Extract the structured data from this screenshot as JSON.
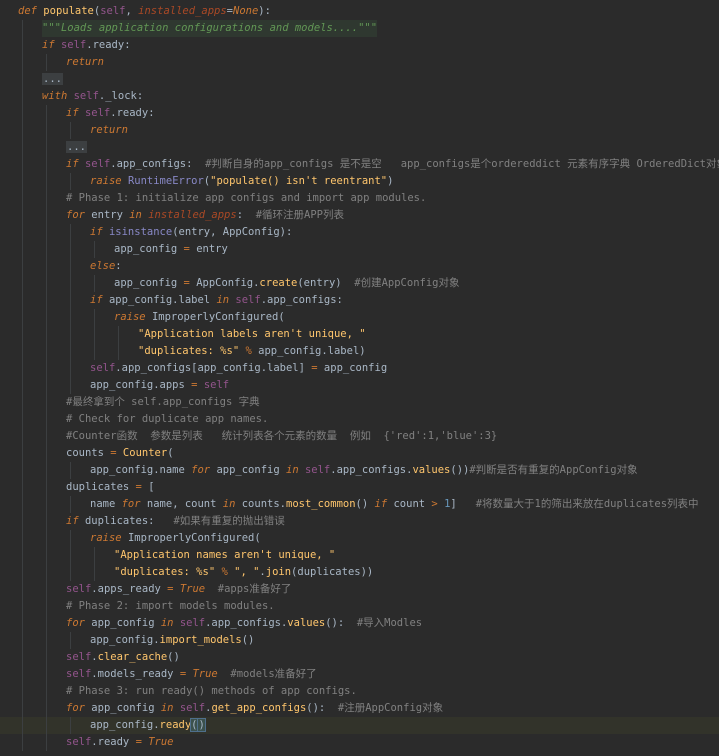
{
  "lines": [
    {
      "indent": 0,
      "tokens": [
        [
          "kw",
          "def "
        ],
        [
          "fn",
          "populate"
        ],
        [
          "name",
          "("
        ],
        [
          "self",
          "self"
        ],
        [
          "name",
          ", "
        ],
        [
          "param",
          "installed_apps"
        ],
        [
          "name",
          "="
        ],
        [
          "kw",
          "None"
        ],
        [
          "name",
          "):"
        ]
      ]
    },
    {
      "indent": 1,
      "doc": true,
      "tokens": [
        [
          "doc",
          "\"\"\"Loads application configurations and models....\"\"\""
        ]
      ]
    },
    {
      "indent": 1,
      "tokens": [
        [
          "kw",
          "if "
        ],
        [
          "self",
          "self"
        ],
        [
          "name",
          ".ready:"
        ]
      ]
    },
    {
      "indent": 2,
      "tokens": [
        [
          "kw",
          "return"
        ]
      ]
    },
    {
      "indent": 1,
      "tokens": [
        [
          "fold",
          "..."
        ]
      ]
    },
    {
      "indent": 1,
      "tokens": [
        [
          "kw",
          "with "
        ],
        [
          "self",
          "self"
        ],
        [
          "name",
          "._lock:"
        ]
      ]
    },
    {
      "indent": 2,
      "tokens": [
        [
          "kw",
          "if "
        ],
        [
          "self",
          "self"
        ],
        [
          "name",
          ".ready:"
        ]
      ]
    },
    {
      "indent": 3,
      "tokens": [
        [
          "kw",
          "return"
        ]
      ]
    },
    {
      "indent": 2,
      "tokens": [
        [
          "fold",
          "..."
        ]
      ]
    },
    {
      "indent": 2,
      "tokens": [
        [
          "kw",
          "if "
        ],
        [
          "self",
          "self"
        ],
        [
          "name",
          ".app_configs:  "
        ],
        [
          "com",
          "#判断自身的app_configs 是不是空   app_configs是个ordereddict 元素有序字典 OrderedDict对象"
        ]
      ]
    },
    {
      "indent": 3,
      "tokens": [
        [
          "kw",
          "raise "
        ],
        [
          "builtin",
          "RuntimeError"
        ],
        [
          "name",
          "("
        ],
        [
          "str",
          "\"populate() isn't reentrant\""
        ],
        [
          "name",
          ")"
        ]
      ]
    },
    {
      "indent": 2,
      "tokens": [
        [
          "com",
          "# Phase 1: initialize app configs and import app modules."
        ]
      ]
    },
    {
      "indent": 2,
      "tokens": [
        [
          "kw",
          "for "
        ],
        [
          "name",
          "entry "
        ],
        [
          "kw",
          "in "
        ],
        [
          "param",
          "installed_apps"
        ],
        [
          "name",
          ":  "
        ],
        [
          "com",
          "#循环注册APP列表"
        ]
      ]
    },
    {
      "indent": 3,
      "tokens": [
        [
          "kw",
          "if "
        ],
        [
          "builtin",
          "isinstance"
        ],
        [
          "name",
          "(entry, AppConfig):"
        ]
      ]
    },
    {
      "indent": 4,
      "tokens": [
        [
          "name",
          "app_config "
        ],
        [
          "kwb",
          "= "
        ],
        [
          "name",
          "entry"
        ]
      ]
    },
    {
      "indent": 3,
      "tokens": [
        [
          "kw",
          "else"
        ],
        [
          "name",
          ":"
        ]
      ]
    },
    {
      "indent": 4,
      "tokens": [
        [
          "name",
          "app_config "
        ],
        [
          "kwb",
          "= "
        ],
        [
          "name",
          "AppConfig."
        ],
        [
          "call",
          "create"
        ],
        [
          "name",
          "(entry)  "
        ],
        [
          "com",
          "#创建AppConfig对象"
        ]
      ]
    },
    {
      "indent": 3,
      "tokens": [
        [
          "kw",
          "if "
        ],
        [
          "name",
          "app_config.label "
        ],
        [
          "kw",
          "in "
        ],
        [
          "self",
          "self"
        ],
        [
          "name",
          ".app_configs:"
        ]
      ]
    },
    {
      "indent": 4,
      "tokens": [
        [
          "kw",
          "raise "
        ],
        [
          "name",
          "ImproperlyConfigured("
        ]
      ]
    },
    {
      "indent": 5,
      "tokens": [
        [
          "str",
          "\"Application labels aren't unique, \""
        ]
      ]
    },
    {
      "indent": 5,
      "tokens": [
        [
          "str",
          "\"duplicates: %s\" "
        ],
        [
          "kwb",
          "% "
        ],
        [
          "name",
          "app_config.label)"
        ]
      ]
    },
    {
      "indent": 3,
      "tokens": [
        [
          "self",
          "self"
        ],
        [
          "name",
          ".app_configs[app_config.label] "
        ],
        [
          "kwb",
          "= "
        ],
        [
          "name",
          "app_config"
        ]
      ]
    },
    {
      "indent": 3,
      "tokens": [
        [
          "name",
          "app_config.apps "
        ],
        [
          "kwb",
          "= "
        ],
        [
          "self",
          "self"
        ]
      ]
    },
    {
      "indent": 2,
      "tokens": [
        [
          "com",
          "#最终拿到个 self.app_configs 字典"
        ]
      ]
    },
    {
      "indent": 2,
      "tokens": [
        [
          "com",
          "# Check for duplicate app names."
        ]
      ]
    },
    {
      "indent": 2,
      "tokens": [
        [
          "com",
          "#Counter函数  参数是列表   统计列表各个元素的数量  例如  {'red':1,'blue':3}"
        ]
      ]
    },
    {
      "indent": 2,
      "tokens": [
        [
          "name",
          "counts "
        ],
        [
          "kwb",
          "= "
        ],
        [
          "call",
          "Counter"
        ],
        [
          "name",
          "("
        ]
      ]
    },
    {
      "indent": 3,
      "tokens": [
        [
          "name",
          "app_config.name "
        ],
        [
          "kw",
          "for "
        ],
        [
          "name",
          "app_config "
        ],
        [
          "kw",
          "in "
        ],
        [
          "self",
          "self"
        ],
        [
          "name",
          ".app_configs."
        ],
        [
          "call",
          "values"
        ],
        [
          "name",
          "())"
        ],
        [
          "com",
          "#判断是否有重复的AppConfig对象"
        ]
      ]
    },
    {
      "indent": 2,
      "tokens": [
        [
          "name",
          "duplicates "
        ],
        [
          "kwb",
          "= "
        ],
        [
          "name",
          "["
        ]
      ]
    },
    {
      "indent": 3,
      "tokens": [
        [
          "name",
          "name "
        ],
        [
          "kw",
          "for "
        ],
        [
          "name",
          "name, count "
        ],
        [
          "kw",
          "in "
        ],
        [
          "name",
          "counts."
        ],
        [
          "call",
          "most_common"
        ],
        [
          "name",
          "() "
        ],
        [
          "kw",
          "if "
        ],
        [
          "name",
          "count "
        ],
        [
          "kwb",
          "> "
        ],
        [
          "num",
          "1"
        ],
        [
          "name",
          "]   "
        ],
        [
          "com",
          "#将数量大于1的筛出来放在duplicates列表中"
        ]
      ]
    },
    {
      "indent": 2,
      "tokens": [
        [
          "kw",
          "if "
        ],
        [
          "name",
          "duplicates:   "
        ],
        [
          "com",
          "#如果有重复的抛出错误"
        ]
      ]
    },
    {
      "indent": 3,
      "tokens": [
        [
          "kw",
          "raise "
        ],
        [
          "name",
          "ImproperlyConfigured("
        ]
      ]
    },
    {
      "indent": 4,
      "tokens": [
        [
          "str",
          "\"Application names aren't unique, \""
        ]
      ]
    },
    {
      "indent": 4,
      "tokens": [
        [
          "str",
          "\"duplicates: %s\" "
        ],
        [
          "kwb",
          "% "
        ],
        [
          "str",
          "\", \""
        ],
        [
          "name",
          "."
        ],
        [
          "call",
          "join"
        ],
        [
          "name",
          "(duplicates))"
        ]
      ]
    },
    {
      "indent": 2,
      "tokens": [
        [
          "self",
          "self"
        ],
        [
          "name",
          ".apps_ready "
        ],
        [
          "kwb",
          "= "
        ],
        [
          "kw",
          "True  "
        ],
        [
          "com",
          "#apps准备好了"
        ]
      ]
    },
    {
      "indent": 2,
      "tokens": [
        [
          "com",
          "# Phase 2: import models modules."
        ]
      ]
    },
    {
      "indent": 2,
      "tokens": [
        [
          "kw",
          "for "
        ],
        [
          "name",
          "app_config "
        ],
        [
          "kw",
          "in "
        ],
        [
          "self",
          "self"
        ],
        [
          "name",
          ".app_configs."
        ],
        [
          "call",
          "values"
        ],
        [
          "name",
          "():  "
        ],
        [
          "com",
          "#导入Modles"
        ]
      ]
    },
    {
      "indent": 3,
      "tokens": [
        [
          "name",
          "app_config."
        ],
        [
          "call",
          "import_models"
        ],
        [
          "name",
          "()"
        ]
      ]
    },
    {
      "indent": 2,
      "tokens": [
        [
          "self",
          "self"
        ],
        [
          "name",
          "."
        ],
        [
          "call",
          "clear_cache"
        ],
        [
          "name",
          "()"
        ]
      ]
    },
    {
      "indent": 2,
      "tokens": [
        [
          "self",
          "self"
        ],
        [
          "name",
          ".models_ready "
        ],
        [
          "kwb",
          "= "
        ],
        [
          "kw",
          "True  "
        ],
        [
          "com",
          "#models准备好了"
        ]
      ]
    },
    {
      "indent": 2,
      "tokens": [
        [
          "com",
          "# Phase 3: run ready() methods of app configs."
        ]
      ]
    },
    {
      "indent": 2,
      "tokens": [
        [
          "kw",
          "for "
        ],
        [
          "name",
          "app_config "
        ],
        [
          "kw",
          "in "
        ],
        [
          "self",
          "self"
        ],
        [
          "name",
          "."
        ],
        [
          "call",
          "get_app_configs"
        ],
        [
          "name",
          "():  "
        ],
        [
          "com",
          "#注册AppConfig对象"
        ]
      ]
    },
    {
      "indent": 3,
      "current": true,
      "tokens": [
        [
          "name",
          "app_config."
        ],
        [
          "call",
          "ready"
        ],
        [
          "match",
          "()"
        ]
      ]
    },
    {
      "indent": 2,
      "tokens": [
        [
          "self",
          "self"
        ],
        [
          "name",
          ".ready "
        ],
        [
          "kwb",
          "= "
        ],
        [
          "kw",
          "True"
        ]
      ]
    }
  ]
}
